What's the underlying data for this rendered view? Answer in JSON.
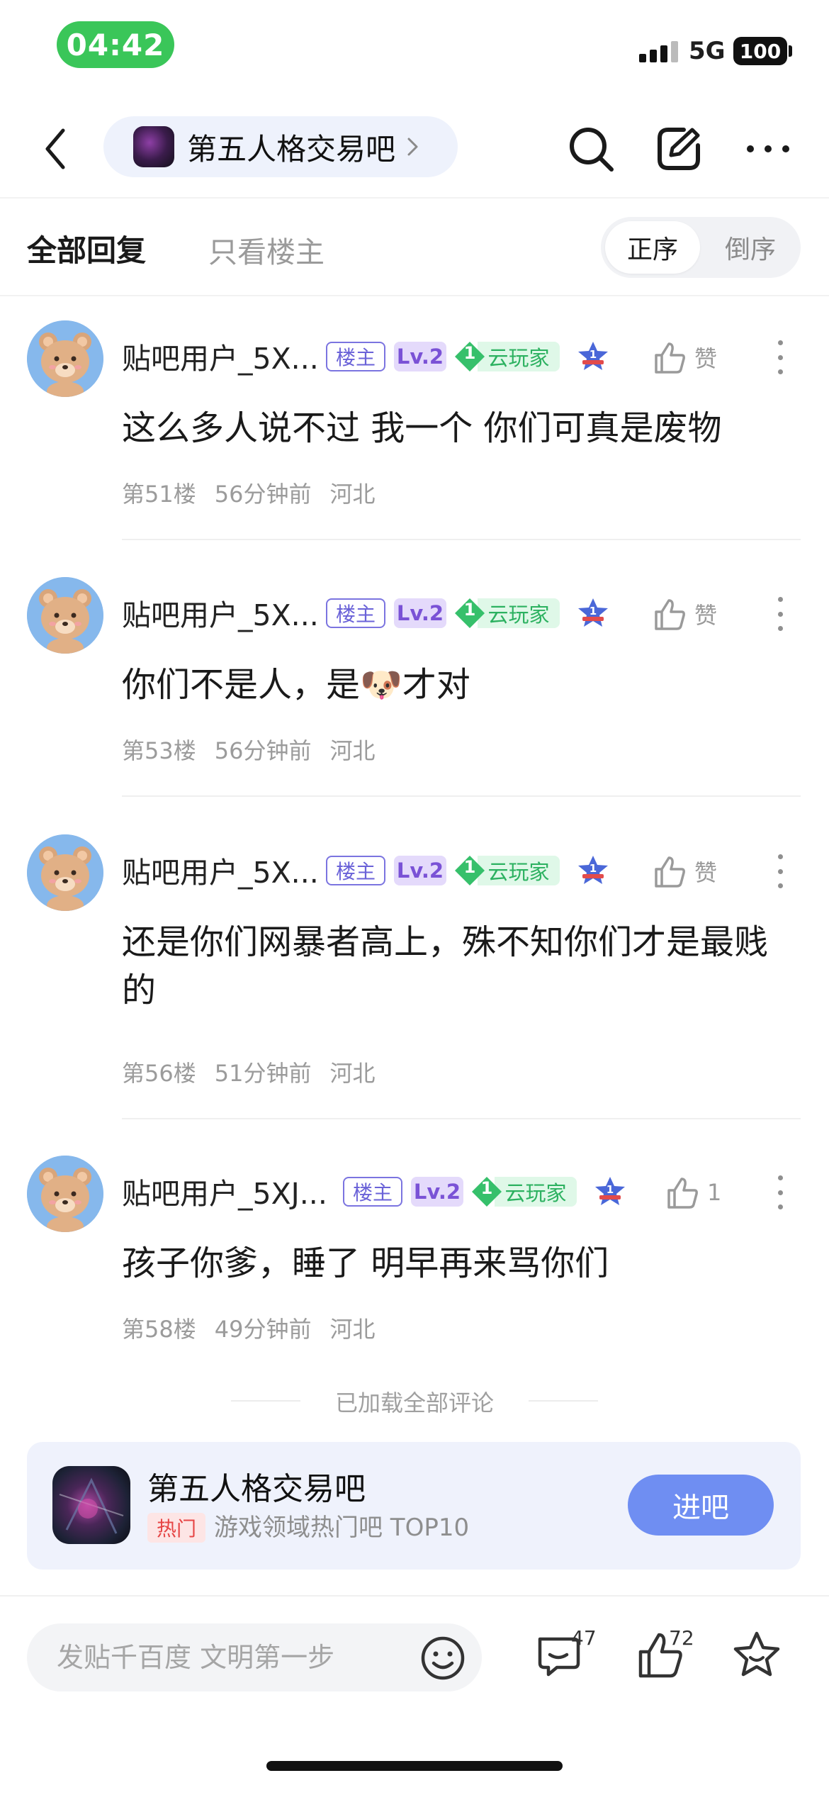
{
  "status_bar": {
    "time": "04:42",
    "network": "5G",
    "battery": "100"
  },
  "nav": {
    "forum_title": "第五人格交易吧",
    "icons": [
      "back-icon",
      "search-icon",
      "share-icon",
      "more-icon"
    ]
  },
  "filter": {
    "tab_all": "全部回复",
    "tab_host_only": "只看楼主",
    "sort_asc": "正序",
    "sort_desc": "倒序"
  },
  "comments": [
    {
      "username": "贴吧用户_5X...",
      "host_badge": "楼主",
      "level": "Lv.2",
      "cloud_level": "1",
      "cloud_badge": "云玩家",
      "rank": "1",
      "like_label": "赞",
      "text": "这么多人说不过 我一个 你们可真是废物",
      "floor": "第51楼",
      "time": "56分钟前",
      "location": "河北"
    },
    {
      "username": "贴吧用户_5X...",
      "host_badge": "楼主",
      "level": "Lv.2",
      "cloud_level": "1",
      "cloud_badge": "云玩家",
      "rank": "1",
      "like_label": "赞",
      "text": "你们不是人，是🐶才对",
      "floor": "第53楼",
      "time": "56分钟前",
      "location": "河北"
    },
    {
      "username": "贴吧用户_5X...",
      "host_badge": "楼主",
      "level": "Lv.2",
      "cloud_level": "1",
      "cloud_badge": "云玩家",
      "rank": "1",
      "like_label": "赞",
      "text": "还是你们网暴者高上，殊不知你们才是最贱的",
      "floor": "第56楼",
      "time": "51分钟前",
      "location": "河北"
    },
    {
      "username": "贴吧用户_5XJ...",
      "host_badge": "楼主",
      "level": "Lv.2",
      "cloud_level": "1",
      "cloud_badge": "云玩家",
      "rank": "1",
      "like_label": "1",
      "text": "孩子你爹，睡了 明早再来骂你们",
      "floor": "第58楼",
      "time": "49分钟前",
      "location": "河北"
    }
  ],
  "loaded_text": "已加载全部评论",
  "forum_card": {
    "name": "第五人格交易吧",
    "hot_badge": "热门",
    "description": "游戏领域热门吧 TOP10",
    "join_label": "进吧"
  },
  "bottom_bar": {
    "input_placeholder": "发贴千百度 文明第一步",
    "comment_count": "47",
    "like_count": "72"
  },
  "colors": {
    "status_green": "#3ac659",
    "accent_blue": "#6f8ef2",
    "host_badge": "#6a62d8",
    "level_badge": "#7a52d6",
    "cloud_green": "#2cb160",
    "hot_red": "#e64545"
  }
}
